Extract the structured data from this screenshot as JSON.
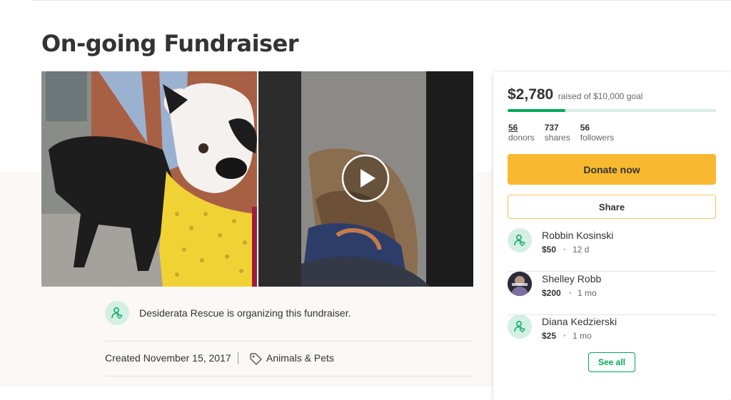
{
  "page": {
    "title": "On-going Fundraiser"
  },
  "media": {
    "photo_subject": "dog-photo",
    "video_subject": "dog-video"
  },
  "organizer": {
    "text": "Desiderata Rescue is organizing this fundraiser.",
    "icon": "organizer-icon"
  },
  "meta": {
    "created": "Created November 15, 2017",
    "category": "Animals & Pets"
  },
  "donation_panel": {
    "raised": "$2,780",
    "goal_text": "raised of $10,000 goal",
    "progress_fraction": 0.278,
    "stats": [
      {
        "num": "56",
        "label": "donors"
      },
      {
        "num": "737",
        "label": "shares"
      },
      {
        "num": "56",
        "label": "followers"
      }
    ],
    "donate_label": "Donate now",
    "share_label": "Share",
    "see_all_label": "See all",
    "donors": [
      {
        "name": "Robbin Kosinski",
        "amount": "$50",
        "time": "12 d",
        "avatar": "default"
      },
      {
        "name": "Shelley Robb",
        "amount": "$200",
        "time": "1 mo",
        "avatar": "photo"
      },
      {
        "name": "Diana Kedzierski",
        "amount": "$25",
        "time": "1 mo",
        "avatar": "default"
      }
    ]
  },
  "colors": {
    "brand_green": "#02a95c",
    "donate_yellow": "#f8b830",
    "progress_track": "#d6ece3",
    "avatar_bg": "#d4efe3"
  }
}
